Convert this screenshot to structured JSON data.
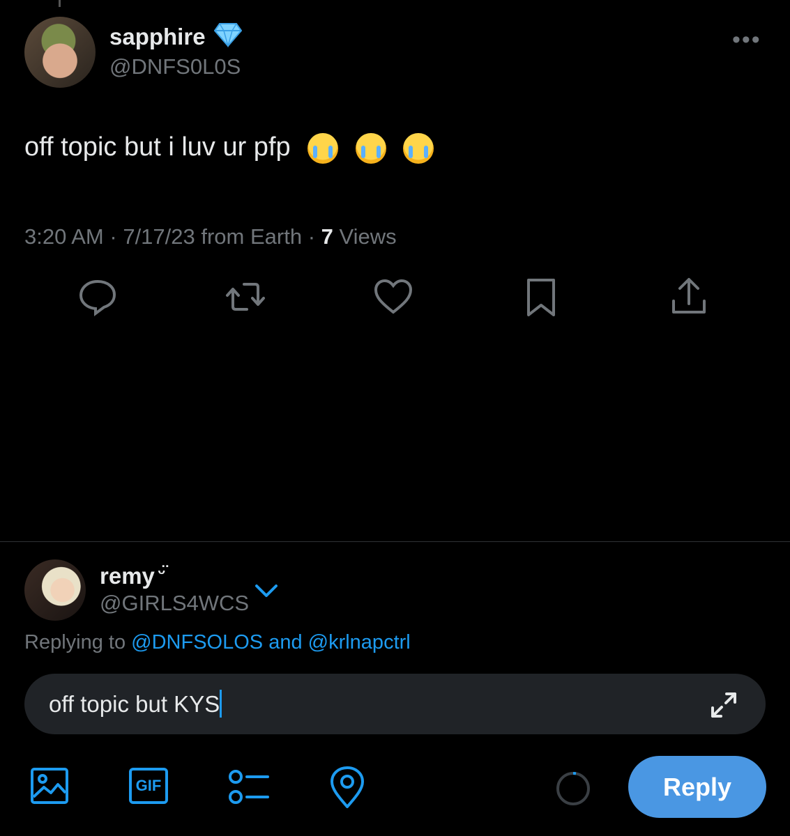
{
  "tweet": {
    "author_name": "sapphire",
    "author_badge_icon": "gem-icon",
    "author_handle": "@DNFS0L0S",
    "more_label": "•••",
    "text": "off topic but i luv ur pfp",
    "emoji_icon": "loudly-crying-face-emoji",
    "emoji_count": 3,
    "time": "3:20 AM",
    "sep1": "·",
    "date_source": "7/17/23 from Earth",
    "sep2": "·",
    "views_count": "7",
    "views_label": "Views",
    "actions": [
      "reply-icon",
      "repost-icon",
      "like-icon",
      "bookmark-icon",
      "share-icon"
    ]
  },
  "reply": {
    "user_name": "remy",
    "user_name_suffix": "ᵕ̈",
    "user_handle": "@GIRLS4WCS",
    "replying_prefix": "Replying to",
    "replying_user1": "@DNFSOLOS",
    "replying_and": "and",
    "replying_user2": "@krlnapctrl",
    "input_value": "off topic but KYS",
    "toolbar": [
      "image-icon",
      "gif-icon",
      "poll-icon",
      "location-icon"
    ],
    "gif_label": "GIF",
    "submit_label": "Reply"
  },
  "colors": {
    "background": "#000000",
    "text": "#e7e9ea",
    "secondary": "#71767b",
    "accent": "#1d9bf0",
    "reply_button": "#4a97e3",
    "compose_bg": "#202327"
  }
}
